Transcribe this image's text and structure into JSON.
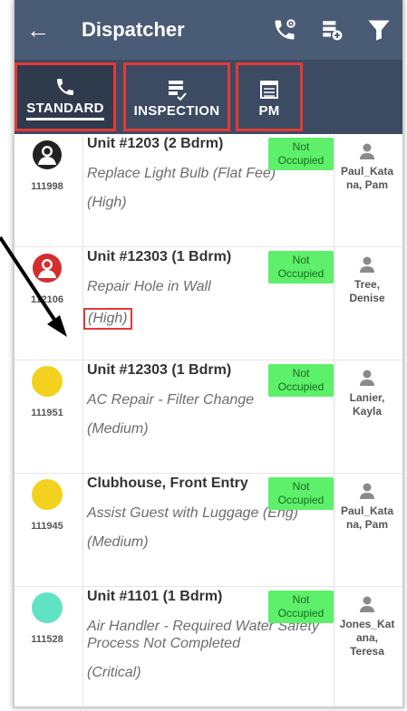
{
  "appbar": {
    "back_label": "←",
    "title": "Dispatcher",
    "icons": [
      "back-arrow-icon",
      "phone-settings-icon",
      "add-list-icon",
      "filter-icon"
    ]
  },
  "tabs": [
    {
      "label": "STANDARD",
      "icon": "phone-icon",
      "active": true
    },
    {
      "label": "INSPECTION",
      "icon": "checklist-icon",
      "active": false
    },
    {
      "label": "PM",
      "icon": "list-icon",
      "active": false
    }
  ],
  "rows": [
    {
      "wo": "111998",
      "avatar": "person-badge",
      "avatar_color": "#222222",
      "unit": "Unit #1203 (2 Bdrm)",
      "badge": "Not Occupied",
      "task": "Replace Light Bulb (Flat Fee)",
      "priority": "(High)",
      "tech": "Paul_Katana, Pam"
    },
    {
      "wo": "112106",
      "avatar": "person-badge",
      "avatar_color": "#d32f2f",
      "unit": "Unit #12303 (1 Bdrm)",
      "badge": "Not Occupied",
      "task": "Repair Hole in Wall",
      "priority": "(High)",
      "tech": "Tree, Denise"
    },
    {
      "wo": "111951",
      "avatar": "circle",
      "avatar_color": "#f3d21f",
      "unit": "Unit #12303 (1 Bdrm)",
      "badge": "Not Occupied",
      "task": "AC Repair - Filter Change",
      "priority": "(Medium)",
      "tech": "Lanier, Kayla"
    },
    {
      "wo": "111945",
      "avatar": "circle",
      "avatar_color": "#f3d21f",
      "unit": "Clubhouse, Front Entry",
      "badge": "Not Occupied",
      "task": "Assist Guest with Luggage (Eng)",
      "priority": "(Medium)",
      "tech": "Paul_Katana, Pam"
    },
    {
      "wo": "111528",
      "avatar": "circle",
      "avatar_color": "#5fe3c4",
      "unit": "Unit #1101 (1 Bdrm)",
      "badge": "Not Occupied",
      "task": "Air Handler - Required Water Safety Process Not Completed",
      "priority": "(Critical)",
      "tech": "Jones_Katana, Teresa"
    }
  ],
  "colors": {
    "appbar": "#4a5b75",
    "tabbar": "#3c4b62",
    "highlight": "#e53935",
    "badge": "#5ef06a"
  }
}
